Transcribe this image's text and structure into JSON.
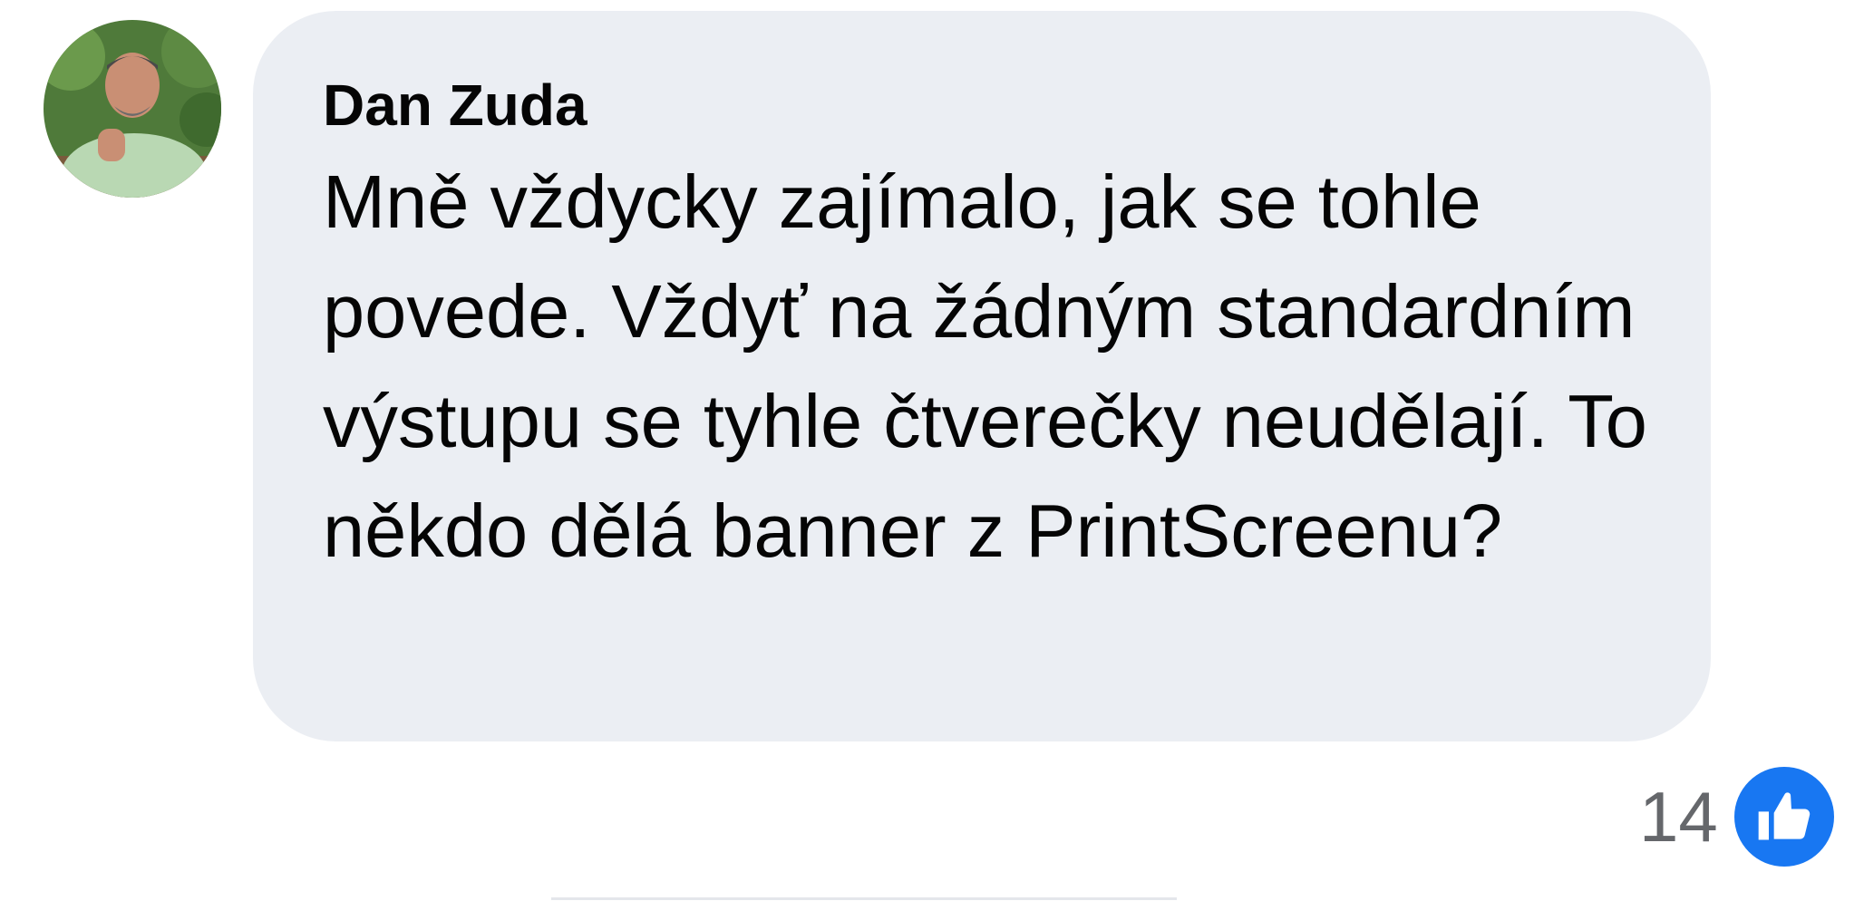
{
  "comment": {
    "author": "Dan Zuda",
    "text": "Mně vždycky zajímalo, jak se tohle povede. Vždyť na žádným standardním výstupu se tyhle čtverečky neudělají. To někdo dělá banner z PrintScreenu?",
    "avatar_icon": "profile-photo",
    "bubble_color": "#ebeef3"
  },
  "reactions": {
    "count": "14",
    "icon": "like-thumbs-up-icon",
    "color": "#1877f2"
  }
}
